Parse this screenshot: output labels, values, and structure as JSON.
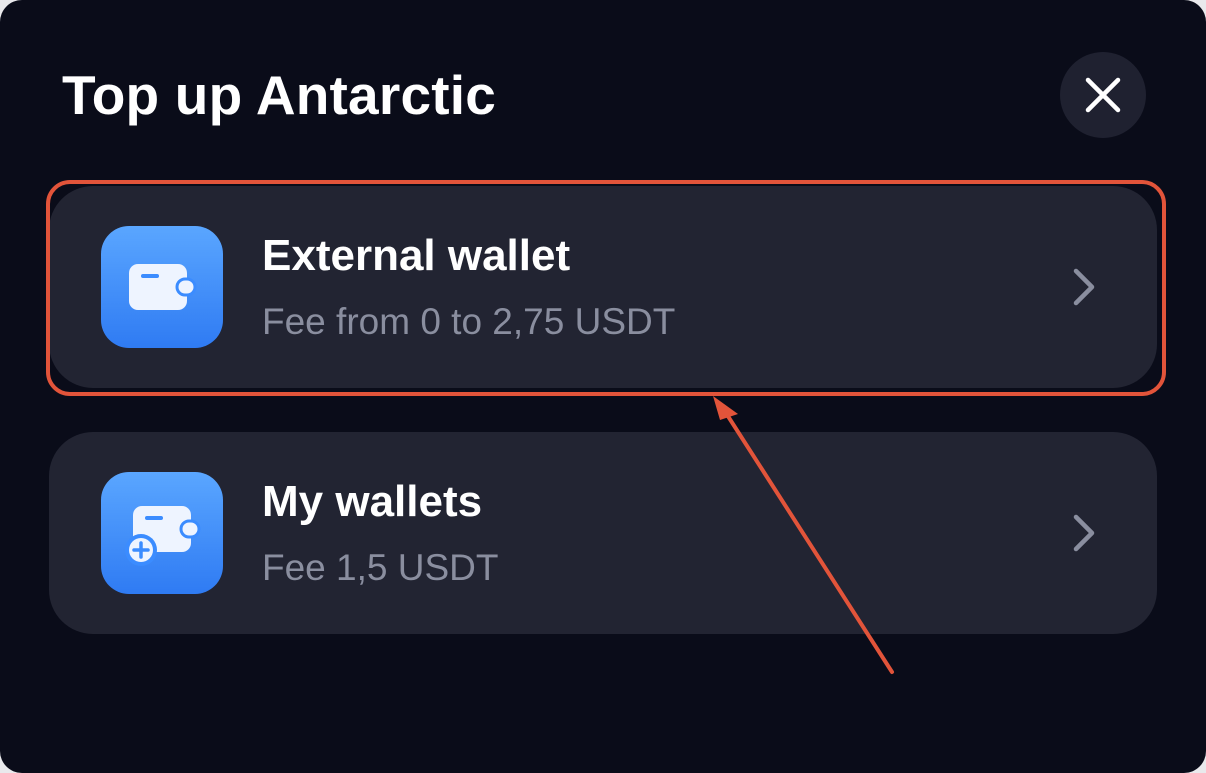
{
  "dialog": {
    "title": "Top up Antarctic",
    "close_icon": "close-icon"
  },
  "options": [
    {
      "title": "External wallet",
      "subtitle": "Fee from 0 to 2,75 USDT",
      "icon": "wallet-icon"
    },
    {
      "title": "My wallets",
      "subtitle": "Fee 1,5 USDT",
      "icon": "wallet-add-icon"
    }
  ],
  "annotation": {
    "highlight_color": "#e2543a",
    "highlighted_option": "External wallet"
  },
  "colors": {
    "background": "#0a0c19",
    "card": "#222432",
    "accent": "#3b8cff",
    "subtitle": "#8a8e9f"
  }
}
